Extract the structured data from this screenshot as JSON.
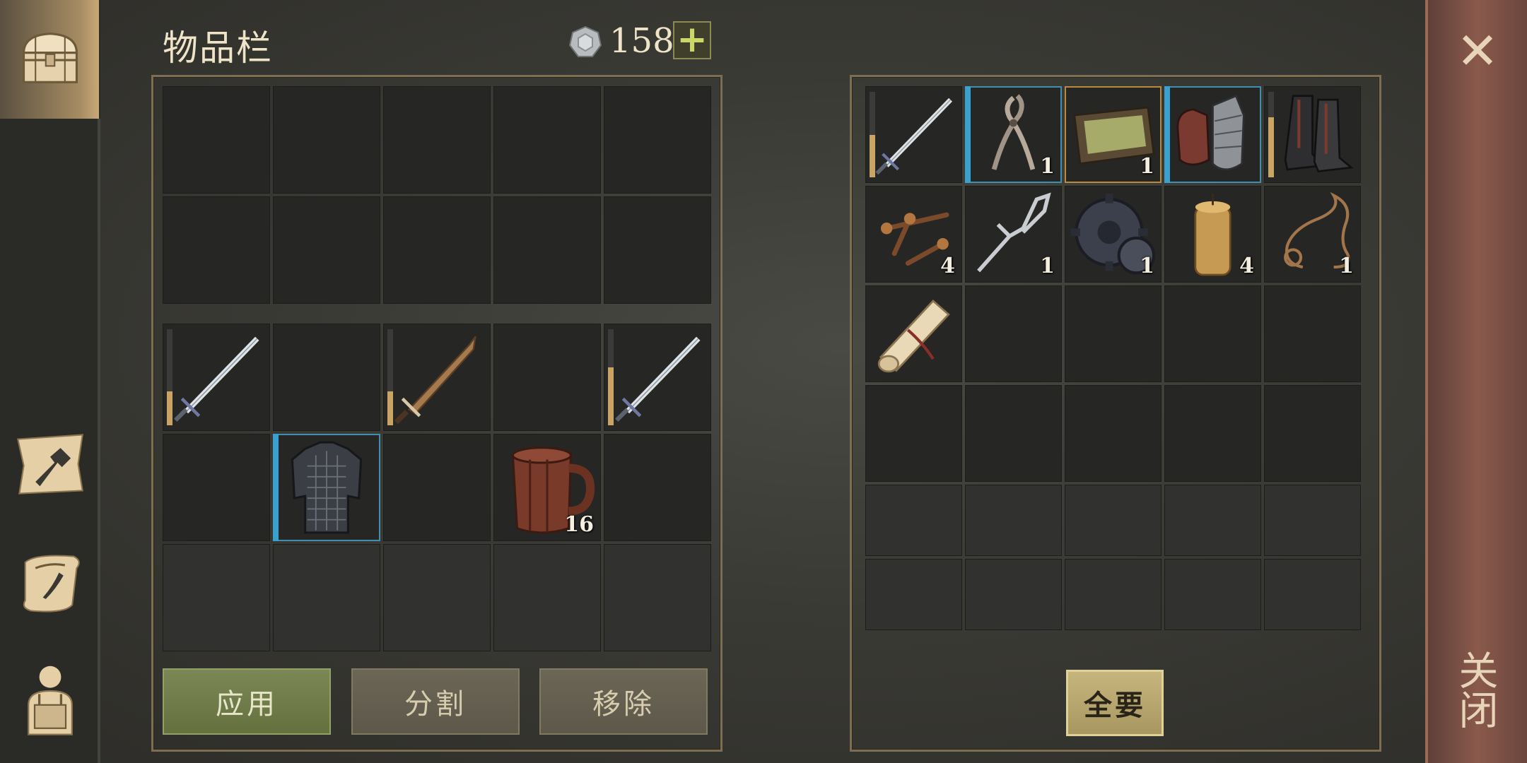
{
  "window": {
    "title": "物品栏",
    "close_label": "关闭",
    "close_icon": "close-x-icon"
  },
  "currency": {
    "amount": "158",
    "add_label": "+",
    "icon": "silver-coin-icon"
  },
  "sidebar": {
    "items": [
      {
        "name": "inventory-chest",
        "icon": "chest-icon",
        "active": true
      },
      {
        "name": "crafting",
        "icon": "hammer-map-icon",
        "active": false
      },
      {
        "name": "quests",
        "icon": "scroll-quill-icon",
        "active": false
      },
      {
        "name": "character",
        "icon": "backpack-character-icon",
        "active": false
      }
    ]
  },
  "inventory": {
    "rows": [
      [
        {},
        {},
        {},
        {},
        {}
      ],
      [
        {},
        {},
        {},
        {},
        {}
      ],
      [
        {
          "item": "sword-icon",
          "durability": 0.35
        },
        {},
        {
          "item": "bronze-sword-icon",
          "durability": 0.35
        },
        {},
        {
          "item": "sword-icon",
          "durability": 0.6
        }
      ],
      [
        {},
        {
          "item": "chainmail-armor-icon",
          "rarity": "blue"
        },
        {},
        {
          "item": "wooden-mug-icon",
          "count": "16"
        },
        {}
      ],
      [
        {
          "dim": true
        },
        {
          "dim": true
        },
        {
          "dim": true
        },
        {
          "dim": true
        },
        {
          "dim": true
        }
      ]
    ],
    "buttons": {
      "apply": "应用",
      "split": "分割",
      "remove": "移除"
    }
  },
  "container": {
    "rows": [
      [
        {
          "item": "sword-icon",
          "durability": 0.5
        },
        {
          "item": "tongs-icon",
          "count": "1",
          "rarity": "blue"
        },
        {
          "item": "tray-icon",
          "count": "1",
          "rarity": "gold"
        },
        {
          "item": "gauntlets-icon",
          "rarity": "blue"
        },
        {
          "item": "boots-icon",
          "durability": 0.7
        }
      ],
      [
        {
          "item": "nails-icon",
          "count": "4"
        },
        {
          "item": "fork-icon",
          "count": "1"
        },
        {
          "item": "gear-icon",
          "count": "1"
        },
        {
          "item": "candle-icon",
          "count": "4"
        },
        {
          "item": "rope-icon",
          "count": "1"
        }
      ],
      [
        {
          "item": "scroll-icon"
        },
        {},
        {},
        {},
        {}
      ],
      [
        {},
        {},
        {},
        {},
        {}
      ],
      [
        {
          "dim": true
        },
        {
          "dim": true
        },
        {
          "dim": true
        },
        {
          "dim": true
        },
        {
          "dim": true
        }
      ],
      [
        {
          "dim": true
        },
        {
          "dim": true
        },
        {
          "dim": true
        },
        {
          "dim": true
        },
        {
          "dim": true
        }
      ]
    ],
    "buttons": {
      "take_all": "全要"
    }
  },
  "colors": {
    "accent_green": "#7b8856",
    "rarity_blue": "#3aa0d0",
    "rarity_gold": "#b98a3c",
    "close_strip": "#8a5a4c"
  }
}
